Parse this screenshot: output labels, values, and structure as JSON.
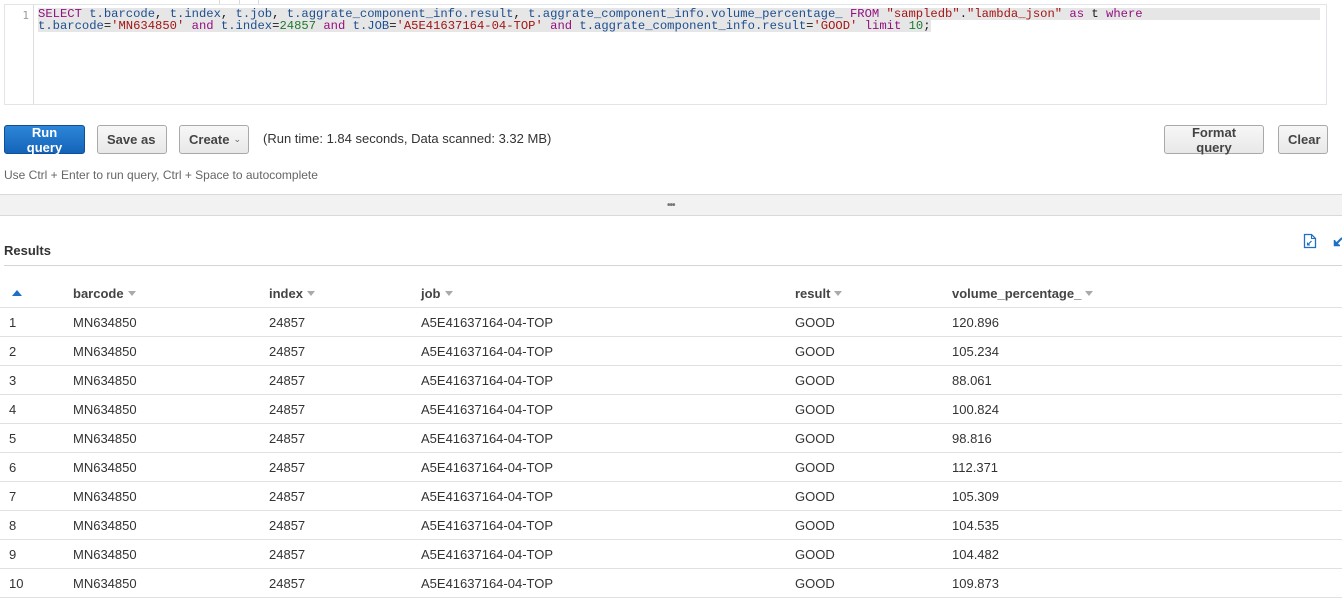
{
  "editor": {
    "line_number": "1",
    "query_lines": [
      [
        {
          "t": "kw",
          "v": "SELECT"
        },
        {
          "t": "op",
          "v": " "
        },
        {
          "t": "id",
          "v": "t.barcode"
        },
        {
          "t": "op",
          "v": ", "
        },
        {
          "t": "id",
          "v": "t.index"
        },
        {
          "t": "op",
          "v": ", "
        },
        {
          "t": "id",
          "v": "t.job"
        },
        {
          "t": "op",
          "v": ", "
        },
        {
          "t": "id",
          "v": "t.aggrate_component_info.result"
        },
        {
          "t": "op",
          "v": ", "
        },
        {
          "t": "id",
          "v": "t.aggrate_component_info.volume_percentage_"
        },
        {
          "t": "op",
          "v": " "
        },
        {
          "t": "kw",
          "v": "FROM"
        },
        {
          "t": "op",
          "v": " "
        },
        {
          "t": "dq",
          "v": "\"sampledb\""
        },
        {
          "t": "op",
          "v": "."
        },
        {
          "t": "dq",
          "v": "\"lambda_json\""
        },
        {
          "t": "op",
          "v": " "
        },
        {
          "t": "kw",
          "v": "as"
        },
        {
          "t": "op",
          "v": " t "
        },
        {
          "t": "kw",
          "v": "where"
        }
      ],
      [
        {
          "t": "id",
          "v": "t.barcode"
        },
        {
          "t": "op",
          "v": "="
        },
        {
          "t": "str",
          "v": "'MN634850'"
        },
        {
          "t": "op",
          "v": " "
        },
        {
          "t": "kw",
          "v": "and"
        },
        {
          "t": "op",
          "v": " "
        },
        {
          "t": "id",
          "v": "t.index"
        },
        {
          "t": "op",
          "v": "="
        },
        {
          "t": "num",
          "v": "24857"
        },
        {
          "t": "op",
          "v": " "
        },
        {
          "t": "kw",
          "v": "and"
        },
        {
          "t": "op",
          "v": " "
        },
        {
          "t": "id",
          "v": "t.JOB"
        },
        {
          "t": "op",
          "v": "="
        },
        {
          "t": "str",
          "v": "'A5E41637164-04-TOP'"
        },
        {
          "t": "op",
          "v": " "
        },
        {
          "t": "kw",
          "v": "and"
        },
        {
          "t": "op",
          "v": " "
        },
        {
          "t": "id",
          "v": "t.aggrate_component_info.result"
        },
        {
          "t": "op",
          "v": "="
        },
        {
          "t": "str",
          "v": "'GOOD'"
        },
        {
          "t": "op",
          "v": " "
        },
        {
          "t": "kw",
          "v": "limit"
        },
        {
          "t": "op",
          "v": " "
        },
        {
          "t": "num",
          "v": "10"
        },
        {
          "t": "op",
          "v": ";"
        }
      ]
    ]
  },
  "toolbar": {
    "run_query_label": "Run query",
    "save_as_label": "Save as",
    "create_label": "Create",
    "run_info": "(Run time: 1.84 seconds, Data scanned: 3.32 MB)",
    "format_query_label": "Format query",
    "clear_label": "Clear",
    "hint": "Use Ctrl + Enter to run query, Ctrl + Space to autocomplete"
  },
  "splitter": {
    "grip": "•••"
  },
  "results": {
    "title": "Results",
    "columns": [
      "barcode",
      "index",
      "job",
      "result",
      "volume_percentage_"
    ],
    "rows": [
      [
        "1",
        "MN634850",
        "24857",
        "A5E41637164-04-TOP",
        "GOOD",
        "120.896"
      ],
      [
        "2",
        "MN634850",
        "24857",
        "A5E41637164-04-TOP",
        "GOOD",
        "105.234"
      ],
      [
        "3",
        "MN634850",
        "24857",
        "A5E41637164-04-TOP",
        "GOOD",
        "88.061"
      ],
      [
        "4",
        "MN634850",
        "24857",
        "A5E41637164-04-TOP",
        "GOOD",
        "100.824"
      ],
      [
        "5",
        "MN634850",
        "24857",
        "A5E41637164-04-TOP",
        "GOOD",
        "98.816"
      ],
      [
        "6",
        "MN634850",
        "24857",
        "A5E41637164-04-TOP",
        "GOOD",
        "112.371"
      ],
      [
        "7",
        "MN634850",
        "24857",
        "A5E41637164-04-TOP",
        "GOOD",
        "105.309"
      ],
      [
        "8",
        "MN634850",
        "24857",
        "A5E41637164-04-TOP",
        "GOOD",
        "104.535"
      ],
      [
        "9",
        "MN634850",
        "24857",
        "A5E41637164-04-TOP",
        "GOOD",
        "104.482"
      ],
      [
        "10",
        "MN634850",
        "24857",
        "A5E41637164-04-TOP",
        "GOOD",
        "109.873"
      ]
    ]
  },
  "colors": {
    "primary_button": "#1f6fc4",
    "keyword": "#930f80",
    "identifier": "#1d4f90",
    "string": "#a31515",
    "number": "#1e7a2f"
  }
}
